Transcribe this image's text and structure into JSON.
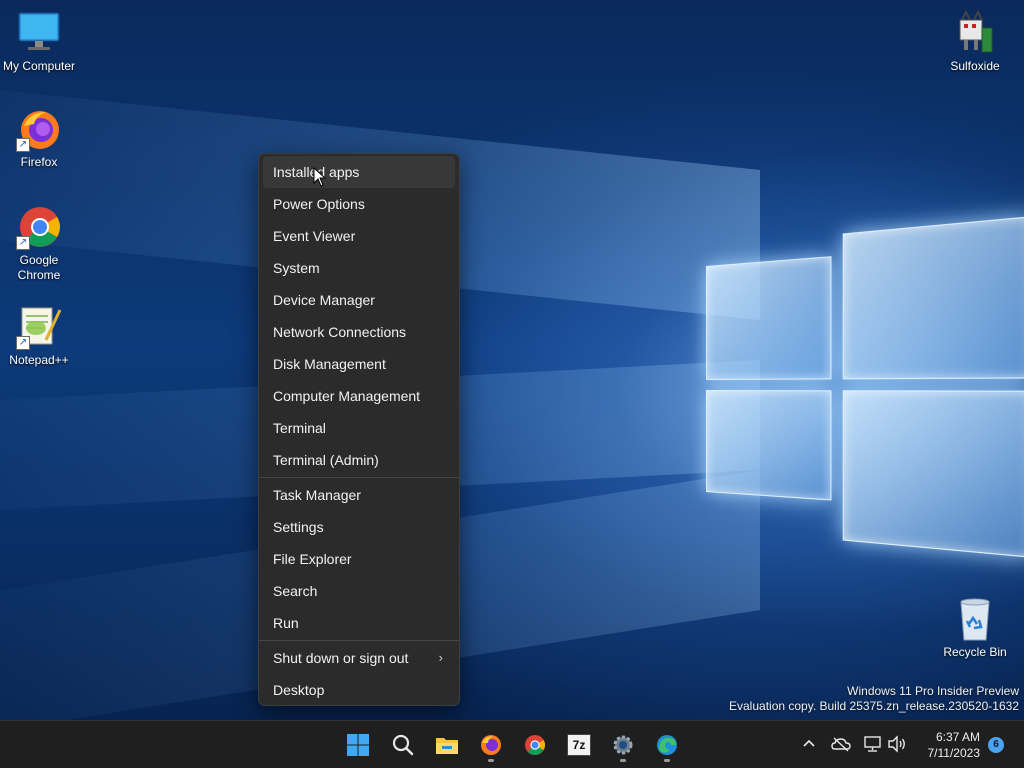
{
  "desktop_icons": {
    "my_computer": "My Computer",
    "firefox": "Firefox",
    "google_chrome": "Google Chrome",
    "notepadpp": "Notepad++",
    "sulfoxide": "Sulfoxide",
    "recycle_bin": "Recycle Bin"
  },
  "context_menu": {
    "group1": [
      "Installed apps",
      "Power Options",
      "Event Viewer",
      "System",
      "Device Manager",
      "Network Connections",
      "Disk Management",
      "Computer Management",
      "Terminal",
      "Terminal (Admin)"
    ],
    "group2": [
      "Task Manager",
      "Settings",
      "File Explorer",
      "Search",
      "Run"
    ],
    "group3": [
      "Shut down or sign out",
      "Desktop"
    ],
    "hovered_item": "Installed apps"
  },
  "watermark": {
    "line1": "Windows 11 Pro Insider Preview",
    "line2": "Evaluation copy. Build 25375.zn_release.230520-1632"
  },
  "taskbar": {
    "apps": [
      "start-icon",
      "search-icon",
      "file-explorer-icon",
      "firefox-icon",
      "chrome-icon",
      "7zip-icon",
      "settings-icon",
      "edge-icon"
    ],
    "sevenzip_label": "7z",
    "time": "6:37 AM",
    "date": "7/11/2023",
    "notification_count": "6"
  },
  "colors": {
    "menu_bg": "#2b2b2b",
    "menu_hover": "#383838",
    "taskbar_bg": "#1f1f1f",
    "accent": "#4aa3f0"
  }
}
